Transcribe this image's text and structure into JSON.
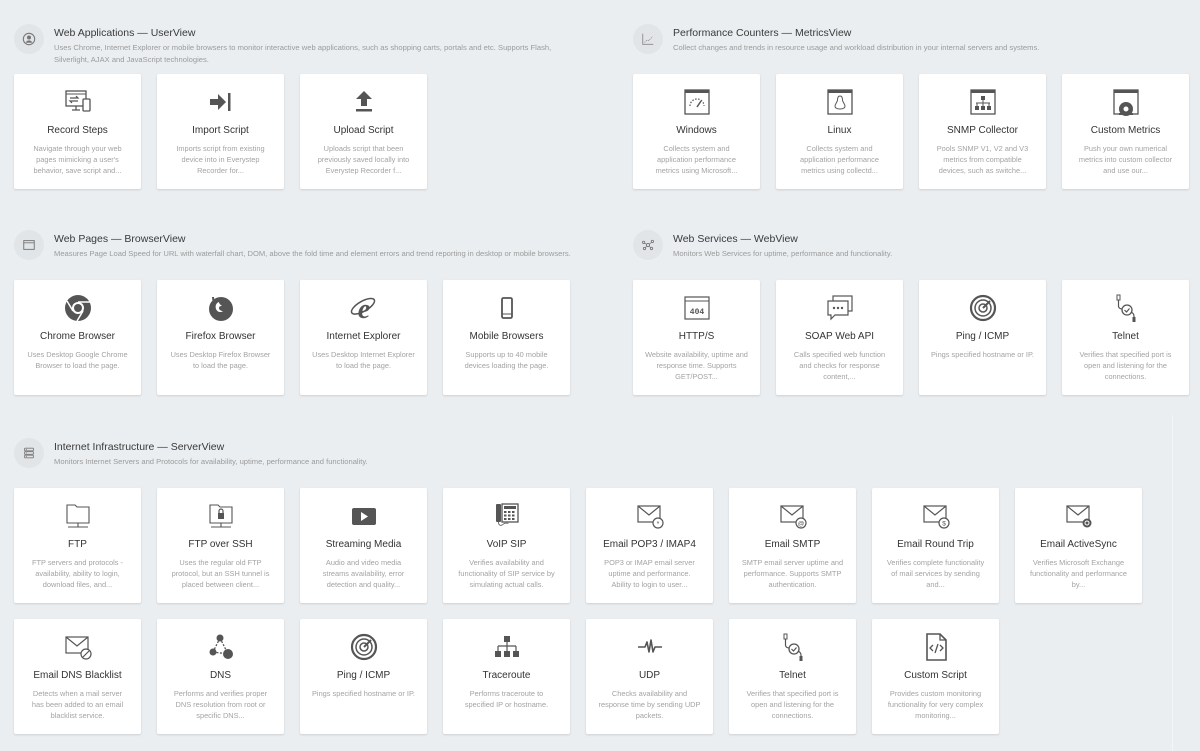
{
  "sections": [
    {
      "id": "userview",
      "icon": "user-icon",
      "title": "Web Applications — UserView",
      "description": "Uses Chrome, Internet Explorer or mobile browsers to monitor interactive web applications, such as shopping carts, portals and etc. Supports Flash, Silverlight, AJAX and JavaScript technologies.",
      "cards": [
        {
          "icon": "record-steps-icon",
          "name": "Record Steps",
          "description": "Navigate through your web pages mimicking a user's behavior, save script and..."
        },
        {
          "icon": "import-script-icon",
          "name": "Import Script",
          "description": "Imports script from existing device into in Everystep Recorder for..."
        },
        {
          "icon": "upload-script-icon",
          "name": "Upload Script",
          "description": "Uploads script that been previously saved locally into Everystep Recorder f..."
        }
      ]
    },
    {
      "id": "metricsview",
      "icon": "chart-icon",
      "title": "Performance Counters — MetricsView",
      "description": "Collect changes and trends in resource usage and workload distribution in your internal servers and systems.",
      "cards": [
        {
          "icon": "windows-gauge-icon",
          "name": "Windows",
          "description": "Collects system and application performance metrics using Microsoft..."
        },
        {
          "icon": "linux-icon",
          "name": "Linux",
          "description": "Collects system and application performance metrics using collectd..."
        },
        {
          "icon": "snmp-collector-icon",
          "name": "SNMP Collector",
          "description": "Pools SNMP V1, V2 and V3 metrics from compatible devices, such as switche..."
        },
        {
          "icon": "custom-metrics-icon",
          "name": "Custom Metrics",
          "description": "Push your own numerical metrics into custom collector and use our..."
        }
      ]
    },
    {
      "id": "browserview",
      "icon": "browser-window-icon",
      "title": "Web Pages — BrowserView",
      "description": "Measures Page Load Speed for URL with waterfall chart, DOM, above the fold time and element errors and trend reporting in desktop or mobile browsers.",
      "cards": [
        {
          "icon": "chrome-icon",
          "name": "Chrome Browser",
          "description": "Uses Desktop Google Chrome Browser to load the page."
        },
        {
          "icon": "firefox-icon",
          "name": "Firefox Browser",
          "description": "Uses Desktop Firefox Browser to load the page."
        },
        {
          "icon": "internet-explorer-icon",
          "name": "Internet Explorer",
          "description": "Uses Desktop Internet Explorer to load the page."
        },
        {
          "icon": "mobile-phone-icon",
          "name": "Mobile Browsers",
          "description": "Supports up to 40 mobile devices loading the page."
        }
      ]
    },
    {
      "id": "webview",
      "icon": "network-nodes-icon",
      "title": "Web Services — WebView",
      "description": "Monitors Web Services for uptime, performance and functionality.",
      "cards": [
        {
          "icon": "http-404-icon",
          "name": "HTTP/S",
          "description": "Website availability, uptime and response time. Supports GET/POST..."
        },
        {
          "icon": "soap-chat-icon",
          "name": "SOAP Web API",
          "description": "Calls specified web function and checks for response content,..."
        },
        {
          "icon": "radar-icon",
          "name": "Ping / ICMP",
          "description": "Pings specified hostname or IP."
        },
        {
          "icon": "telnet-cable-icon",
          "name": "Telnet",
          "description": "Verifies that specified port is open and listening for the connections."
        }
      ]
    },
    {
      "id": "serverview",
      "icon": "server-icon",
      "title": "Internet Infrastructure — ServerView",
      "description": "Monitors Internet Servers and Protocols for availability, uptime, performance and functionality.",
      "cards": [
        {
          "icon": "ftp-folder-icon",
          "name": "FTP",
          "description": "FTP servers and protocols - availability, ability to login, download files, and..."
        },
        {
          "icon": "ftp-lock-folder-icon",
          "name": "FTP over SSH",
          "description": "Uses the regular old FTP protocol, but an SSH tunnel is placed between client..."
        },
        {
          "icon": "play-icon",
          "name": "Streaming Media",
          "description": "Audio and video media streams availability, error detection and quality..."
        },
        {
          "icon": "desk-phone-icon",
          "name": "VoIP SIP",
          "description": "Verifies availability and functionality of SIP service by simulating actual calls."
        },
        {
          "icon": "email-star-icon",
          "name": "Email POP3 / IMAP4",
          "description": "POP3 or IMAP email server uptime and performance. Ability to login to user..."
        },
        {
          "icon": "email-at-icon",
          "name": "Email SMTP",
          "description": "SMTP email server uptime and performance. Supports SMTP authentication."
        },
        {
          "icon": "email-dollar-icon",
          "name": "Email Round Trip",
          "description": "Verifies complete functionality of mail services by sending and..."
        },
        {
          "icon": "email-sync-icon",
          "name": "Email ActiveSync",
          "description": "Verifies Microsoft Exchange functionality and performance by..."
        },
        {
          "icon": "email-blocked-icon",
          "name": "Email DNS Blacklist",
          "description": "Detects when a mail server has been added to an email blacklist service."
        },
        {
          "icon": "dns-nodes-icon",
          "name": "DNS",
          "description": "Performs and verifies proper DNS resolution from root or specific DNS..."
        },
        {
          "icon": "radar-icon",
          "name": "Ping / ICMP",
          "description": "Pings specified hostname or IP."
        },
        {
          "icon": "traceroute-icon",
          "name": "Traceroute",
          "description": "Performs traceroute to specified IP or hostname."
        },
        {
          "icon": "pulse-icon",
          "name": "UDP",
          "description": "Checks availability and response time by sending UDP packets."
        },
        {
          "icon": "telnet-cable-icon",
          "name": "Telnet",
          "description": "Verifies that specified port is open and listening for the connections."
        },
        {
          "icon": "code-file-icon",
          "name": "Custom Script",
          "description": "Provides custom monitoring functionality for very complex monitoring..."
        }
      ]
    }
  ]
}
